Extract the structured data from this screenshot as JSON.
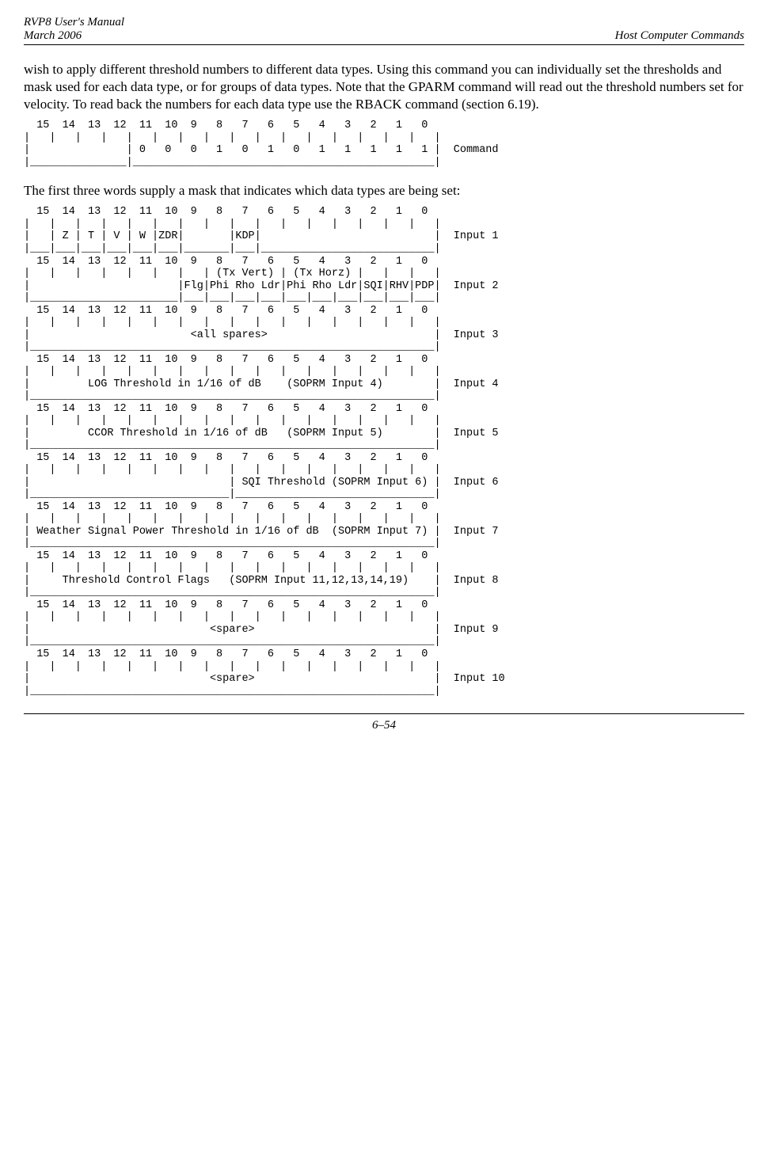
{
  "header": {
    "left_line1": "RVP8 User's Manual",
    "left_line2": "March 2006",
    "right": "Host Computer Commands"
  },
  "para1": "wish to apply different threshold numbers to different data types.  Using this command you can individually set the thresholds and mask used for each data type, or for groups of data types.  Note that the GPARM command will read out the threshold numbers set for velocity.  To read back the numbers for each data type use the RBACK command (section 6.19).",
  "diagram_cmd": "  15  14  13  12  11  10  9   8   7   6   5   4   3   2   1   0 \n|   |   |   |   |   |   |   |   |   |   |   |   |   |   |   |   |\n|               | 0   0   0   1   0   1   0   1   1   1   1   1 |  Command\n|_______________|_______________________________________________|",
  "para2": "The first three words supply a mask that indicates which data types are being set:",
  "diagram_inputs": "  15  14  13  12  11  10  9   8   7   6   5   4   3   2   1   0 \n|   |   |   |   |   |   |   |   |   |   |   |   |   |   |   |   |\n|   | Z | T | V | W |ZDR|       |KDP|                           |  Input 1\n|___|___|___|___|___|___|_______|___|___________________________|\n  15  14  13  12  11  10  9   8   7   6   5   4   3   2   1   0 \n|   |   |   |   |   |   |   | (Tx Vert) | (Tx Horz) |   |   |   |\n|                       |Flg|Phi Rho Ldr|Phi Rho Ldr|SQI|RHV|PDP|  Input 2\n|_______________________|___|___|___|___|___|___|___|___|___|___|\n  15  14  13  12  11  10  9   8   7   6   5   4   3   2   1   0 \n|   |   |   |   |   |   |   |   |   |   |   |   |   |   |   |   |\n|                         <all spares>                          |  Input 3\n|_______________________________________________________________|\n  15  14  13  12  11  10  9   8   7   6   5   4   3   2   1   0 \n|   |   |   |   |   |   |   |   |   |   |   |   |   |   |   |   |\n|         LOG Threshold in 1/16 of dB    (SOPRM Input 4)        |  Input 4\n|_______________________________________________________________|\n  15  14  13  12  11  10  9   8   7   6   5   4   3   2   1   0 \n|   |   |   |   |   |   |   |   |   |   |   |   |   |   |   |   |\n|         CCOR Threshold in 1/16 of dB   (SOPRM Input 5)        |  Input 5\n|_______________________________________________________________|\n  15  14  13  12  11  10  9   8   7   6   5   4   3   2   1   0 \n|   |   |   |   |   |   |   |   |   |   |   |   |   |   |   |   |\n|                               | SQI Threshold (SOPRM Input 6) |  Input 6\n|_______________________________|_______________________________|\n  15  14  13  12  11  10  9   8   7   6   5   4   3   2   1   0 \n|   |   |   |   |   |   |   |   |   |   |   |   |   |   |   |   |\n| Weather Signal Power Threshold in 1/16 of dB  (SOPRM Input 7) |  Input 7\n|_______________________________________________________________|\n  15  14  13  12  11  10  9   8   7   6   5   4   3   2   1   0 \n|   |   |   |   |   |   |   |   |   |   |   |   |   |   |   |   |\n|     Threshold Control Flags   (SOPRM Input 11,12,13,14,19)    |  Input 8\n|_______________________________________________________________|\n  15  14  13  12  11  10  9   8   7   6   5   4   3   2   1   0 \n|   |   |   |   |   |   |   |   |   |   |   |   |   |   |   |   |\n|                            <spare>                            |  Input 9\n|_______________________________________________________________|\n  15  14  13  12  11  10  9   8   7   6   5   4   3   2   1   0 \n|   |   |   |   |   |   |   |   |   |   |   |   |   |   |   |   |\n|                            <spare>                            |  Input 10\n|_______________________________________________________________|",
  "footer": "6–54"
}
